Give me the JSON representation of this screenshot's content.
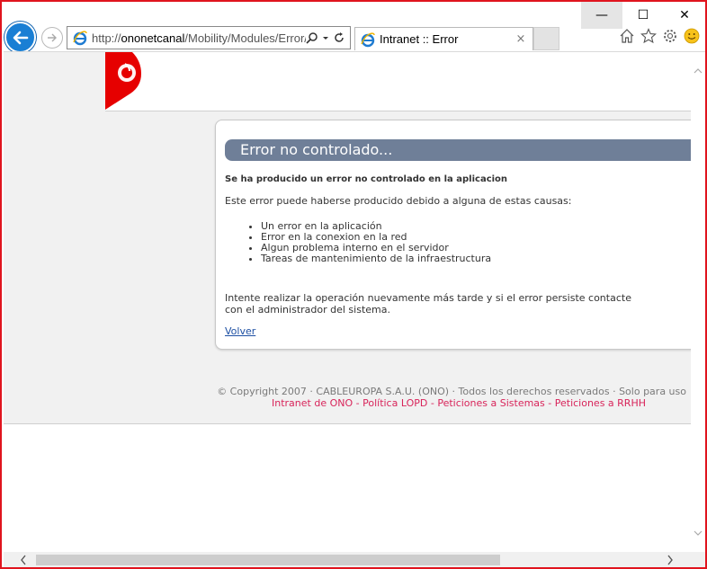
{
  "browser": {
    "url_prefix": "http://",
    "url_host": "ononetcanal",
    "url_path": "/Mobility/Modules/Error/",
    "tab_title": "Intranet :: Error",
    "tab_close": "×",
    "window_controls": {
      "minimize": "—",
      "maximize": "☐",
      "close": "✕"
    }
  },
  "page": {
    "panel_title": "Error no controlado...",
    "subtitle": "Se ha producido un error no controlado en la aplicacion",
    "intro": "Este error puede haberse producido debido a alguna de estas causas:",
    "causes": [
      "Un error en la aplicación",
      "Error en la conexion en la red",
      "Algun problema interno en el servidor",
      "Tareas de mantenimiento de la infraestructura"
    ],
    "footnote_line1": "Intente realizar la operación nuevamente más tarde y si el error persiste contacte",
    "footnote_line2": "con el administrador del sistema.",
    "back_link": "Volver"
  },
  "footer": {
    "copyright": "© Copyright 2007 · CABLEUROPA S.A.U. (ONO) · Todos los derechos reservados · Solo para uso",
    "links": [
      "Intranet de ONO",
      "Política LOPD",
      "Peticiones a Sistemas",
      "Peticiones a RRHH"
    ],
    "link_separator": " - "
  },
  "colors": {
    "window_border": "#e0141e",
    "brand_red": "#e60000",
    "panel_header": "#6f7f98",
    "link_pink": "#d8245a",
    "link_blue": "#1d4fa3"
  },
  "icons": [
    "back-arrow-icon",
    "forward-arrow-icon",
    "ie-logo-icon",
    "search-icon",
    "dropdown-icon",
    "refresh-icon",
    "home-icon",
    "star-icon",
    "gear-icon",
    "smiley-icon",
    "vodafone-logo-icon"
  ]
}
